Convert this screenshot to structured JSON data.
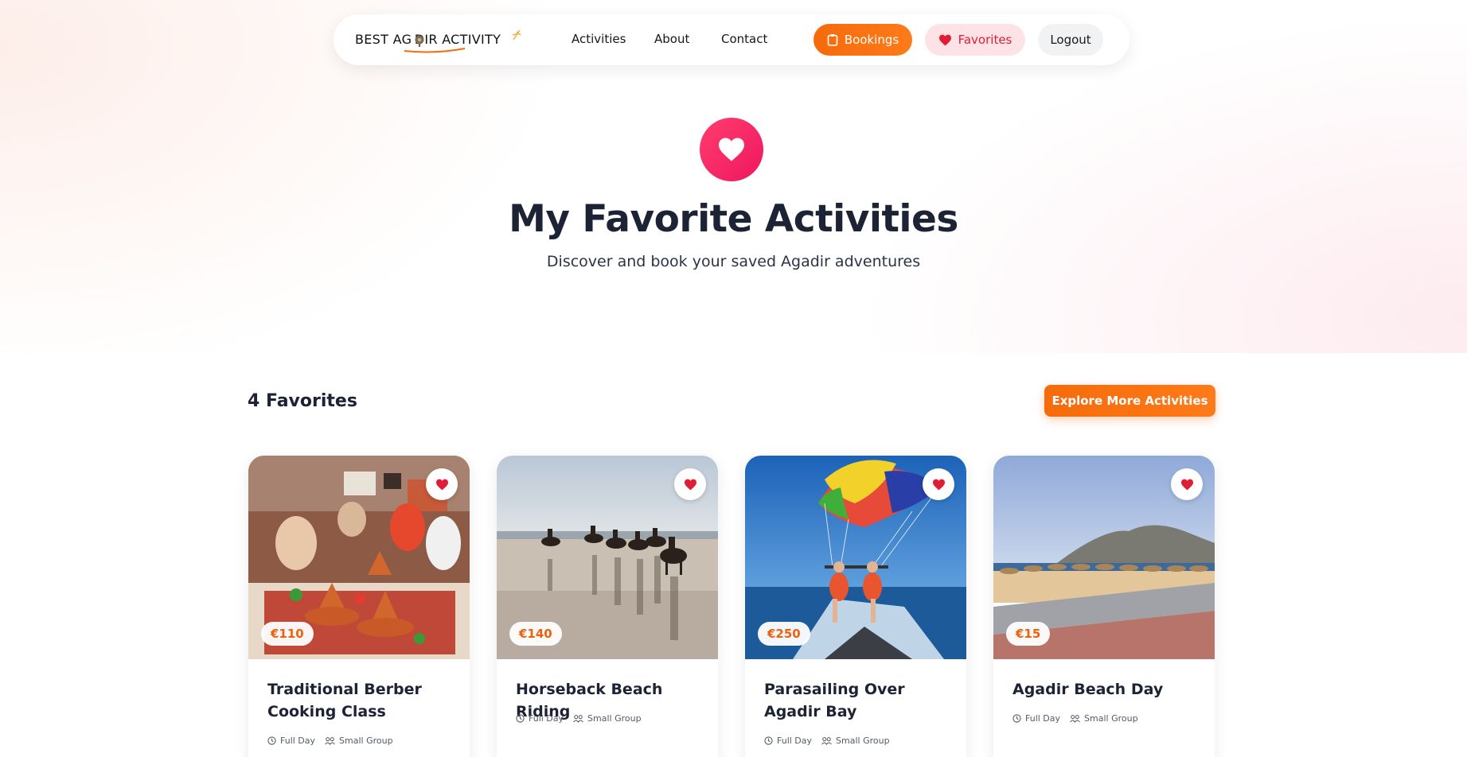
{
  "nav": {
    "logo_text": "BEST AG DIR ACTIVITY",
    "links": [
      "Activities",
      "About",
      "Contact"
    ],
    "bookings_label": "Bookings",
    "favorites_label": "Favorites",
    "logout_label": "Logout"
  },
  "hero": {
    "title": "My Favorite Activities",
    "subtitle": "Discover and book your saved Agadir adventures"
  },
  "section": {
    "count_label": "4 Favorites",
    "explore_label": "Explore More Activities"
  },
  "cards": [
    {
      "title": "Traditional Berber Cooking Class",
      "price": "€110",
      "duration": "Full Day",
      "group": "Small Group",
      "image": "cooking-class-photo"
    },
    {
      "title": "Horseback Beach Riding",
      "price": "€140",
      "duration": "Full Day",
      "group": "Small Group",
      "image": "horse-riding-photo"
    },
    {
      "title": "Parasailing Over Agadir Bay",
      "price": "€250",
      "duration": "Full Day",
      "group": "Small Group",
      "image": "parasailing-photo"
    },
    {
      "title": "Agadir Beach Day",
      "price": "€15",
      "duration": "Full Day",
      "group": "Small Group",
      "image": "beach-photo"
    }
  ],
  "colors": {
    "accent_orange": "#f56b0c",
    "favorite_red": "#e11d35",
    "hero_heart_pink": "#ef1760",
    "text_dark": "#1b2334"
  },
  "icons": {
    "bookings": "clipboard-icon",
    "favorites": "heart-icon",
    "hero": "heart-icon",
    "duration": "clock-icon",
    "group": "group-icon"
  }
}
